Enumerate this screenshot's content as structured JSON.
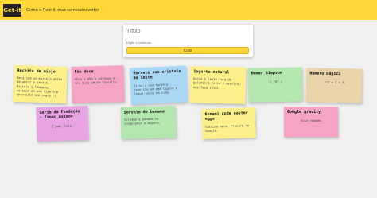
{
  "header": {
    "logo_text": "Get-it",
    "tagline": "Como o Post-it, mas com outro verbo",
    "bg_color": "#fdd73a"
  },
  "form": {
    "title_placeholder": "Título",
    "content_placeholder": "Digite o conteúdo...",
    "create_label": "Criar"
  },
  "notes": [
    {
      "title": "Receita de miojo",
      "body": "Bata com um martelo antes de abrir o pacote. Misture o tempero, coloque em uma tigela e aproveite seu snack :)",
      "color": "#fdf08a"
    },
    {
      "title": "Pão doce",
      "body": "Abra o pão e coloque o seu suco em pó favorito.",
      "color": "#f6a4c6"
    },
    {
      "title": "Sorvete com cristais de leite",
      "body": "Sirva o seu sorvete favorito em uma tigela e jogue leite em cima.",
      "color": "#a9d8f4"
    },
    {
      "title": "Iogurte natural",
      "body": "Deixe o leite fora da geladeira (este é mentira, não faça isto).",
      "color": "#fdf08a"
    },
    {
      "title": "Nomer Simpson",
      "body": "-(_^O^_)",
      "color": "#b4e6b0"
    },
    {
      "title": "Numero mágico",
      "body": "n^2 + 1 = 5",
      "color": "#e9d3a8"
    },
    {
      "title": "Série da Fundação - Isaac Asimov",
      "body": "É boa, leia.",
      "color": "#e8a3e3"
    },
    {
      "title": "Sorvete de banana",
      "body": "Coloque a banana no congelador e espere.",
      "color": "#b4e6b0"
    },
    {
      "title": "Konami code easter eggs",
      "body": "Cultura nerd. Procure no Google.",
      "color": "#fdf08a"
    },
    {
      "title": "Google gravity",
      "body": "Rise também",
      "color": "#f6a4c6"
    }
  ]
}
